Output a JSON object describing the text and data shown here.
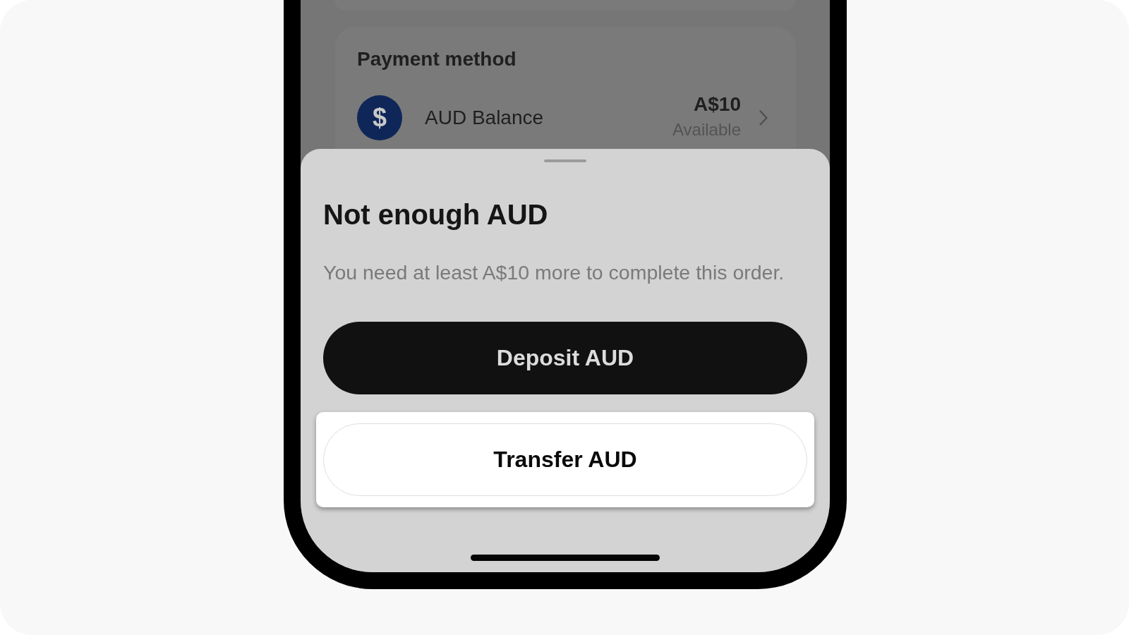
{
  "background_screen": {
    "payment_method": {
      "title": "Payment method",
      "option": {
        "icon": "$",
        "name": "AUD Balance",
        "amount": "A$10",
        "note": "Available"
      }
    }
  },
  "bottom_sheet": {
    "title": "Not enough AUD",
    "message": "You need at least A$10 more to complete this order.",
    "buttons": [
      {
        "label": "Deposit AUD",
        "kind": "filled",
        "highlighted": false
      },
      {
        "label": "Transfer AUD",
        "kind": "outline",
        "highlighted": true
      }
    ]
  }
}
